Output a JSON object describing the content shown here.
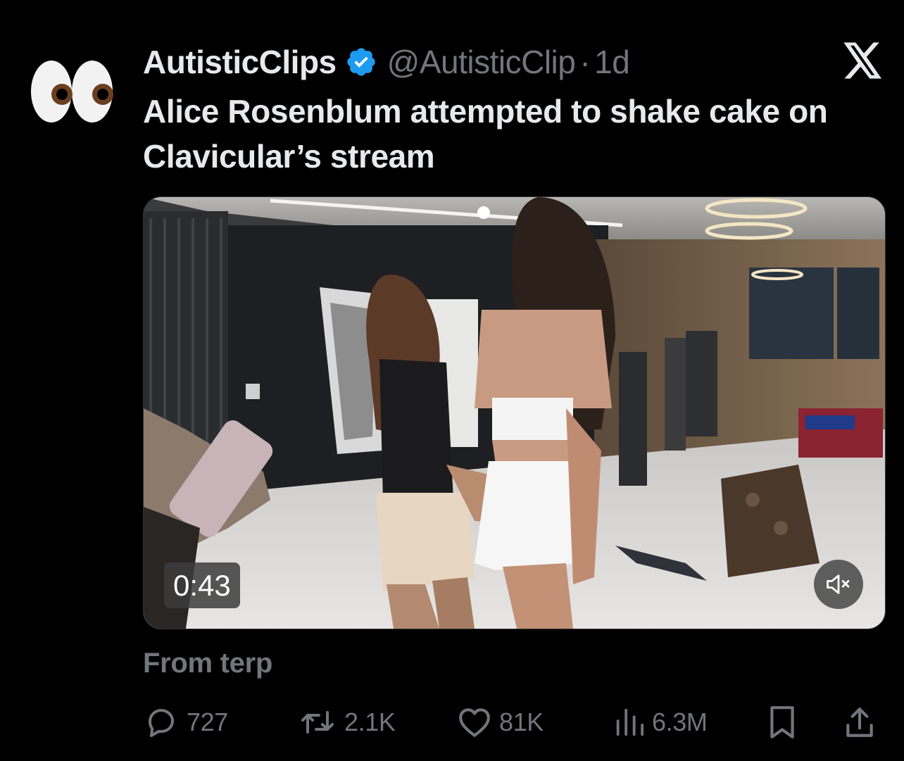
{
  "author": {
    "display_name": "AutisticClips",
    "handle": "@AutisticClip",
    "separator": "·",
    "timestamp": "1d",
    "verified": true,
    "avatar_icon": "eyes-emoji"
  },
  "tweet": {
    "text": "Alice Rosenblum attempted to shake cake on Clavicular’s stream"
  },
  "media": {
    "type": "video",
    "duration": "0:43",
    "muted": true
  },
  "source": {
    "text": "From terp"
  },
  "actions": {
    "replies": "727",
    "reposts": "2.1K",
    "likes": "81K",
    "views": "6.3M"
  },
  "colors": {
    "background": "#000000",
    "primary_text": "#e7e9ea",
    "secondary_text": "#71767b",
    "verified_badge": "#1d9bf0"
  }
}
